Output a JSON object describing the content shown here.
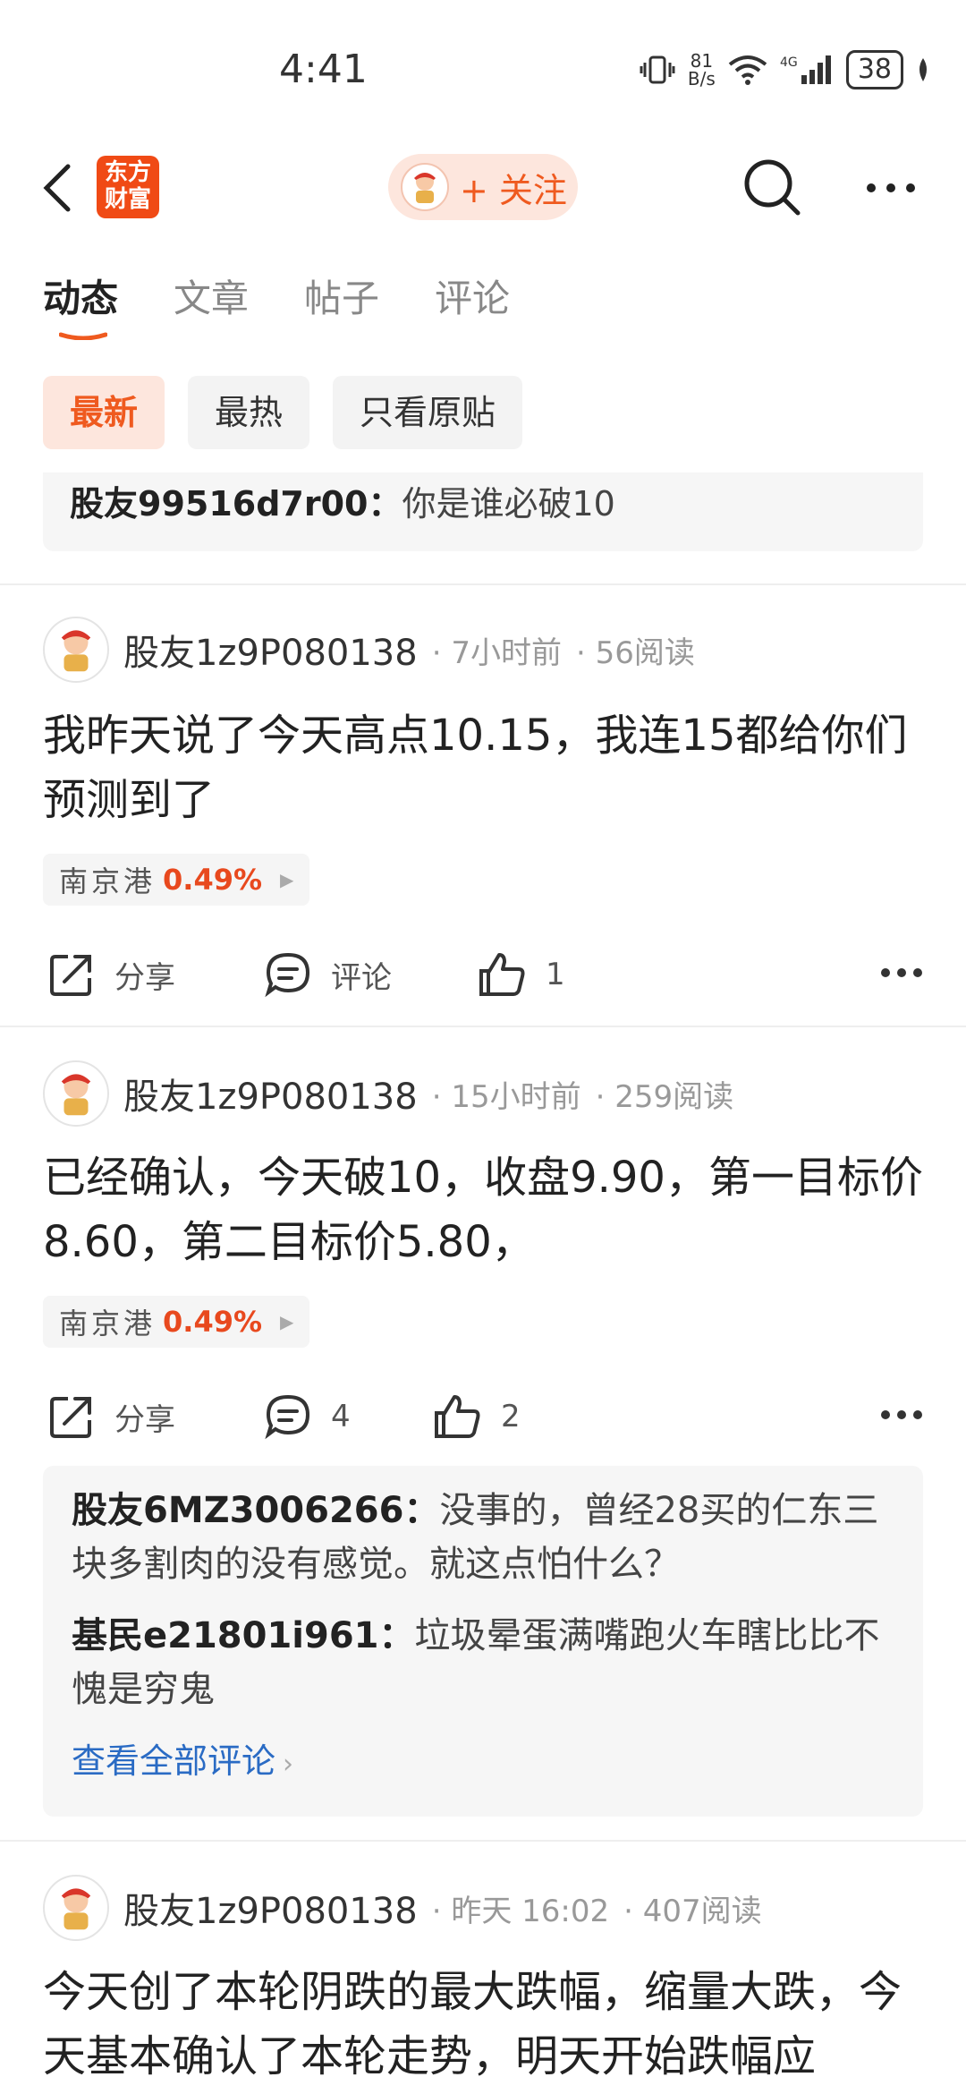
{
  "status": {
    "time": "4:41",
    "speed": "81\nB/s",
    "net": "6⁺",
    "net2": "4G",
    "battery": "38"
  },
  "header": {
    "logo": "东方\n财富",
    "follow_label": "+ 关注"
  },
  "tabs": [
    {
      "label": "动态"
    },
    {
      "label": "文章"
    },
    {
      "label": "帖子"
    },
    {
      "label": "评论"
    }
  ],
  "filters": [
    {
      "label": "最新"
    },
    {
      "label": "最热"
    },
    {
      "label": "只看原贴"
    }
  ],
  "top_comment": {
    "user": "股友99516d7r00：",
    "text": "你是谁必破10"
  },
  "posts": [
    {
      "user": "股友1z9P080138",
      "time": "· 7小时前",
      "reads": "· 56阅读",
      "text": "我昨天说了今天高点10.15，我连15都给你们预测到了",
      "stock": {
        "name": "南京港",
        "pct": "0.49%"
      },
      "share": "分享",
      "comment": "评论",
      "likes": "1"
    },
    {
      "user": "股友1z9P080138",
      "time": "· 15小时前",
      "reads": "· 259阅读",
      "text": "已经确认，今天破10，收盘9.90，第一目标价8.60，第二目标价5.80，",
      "stock": {
        "name": "南京港",
        "pct": "0.49%"
      },
      "share": "分享",
      "comment": "4",
      "likes": "2",
      "comments": [
        {
          "user": "股友6MZ3006266：",
          "text": "没事的，曾经28买的仁东三块多割肉的没有感觉。就这点怕什么？"
        },
        {
          "user": "基民e21801i961：",
          "text": "垃圾晕蛋满嘴跑火车瞎比比不愧是穷鬼"
        }
      ],
      "view_all": "查看全部评论"
    },
    {
      "user": "股友1z9P080138",
      "time": "· 昨天 16:02",
      "reads": "· 407阅读",
      "text": "今天创了本轮阴跌的最大跌幅，缩量大跌，今天基本确认了本轮走势，明天开始跌幅应"
    }
  ],
  "colors": {
    "accent": "#ef5a1f",
    "link": "#2a6bc4",
    "stock_up": "#e8491e"
  }
}
